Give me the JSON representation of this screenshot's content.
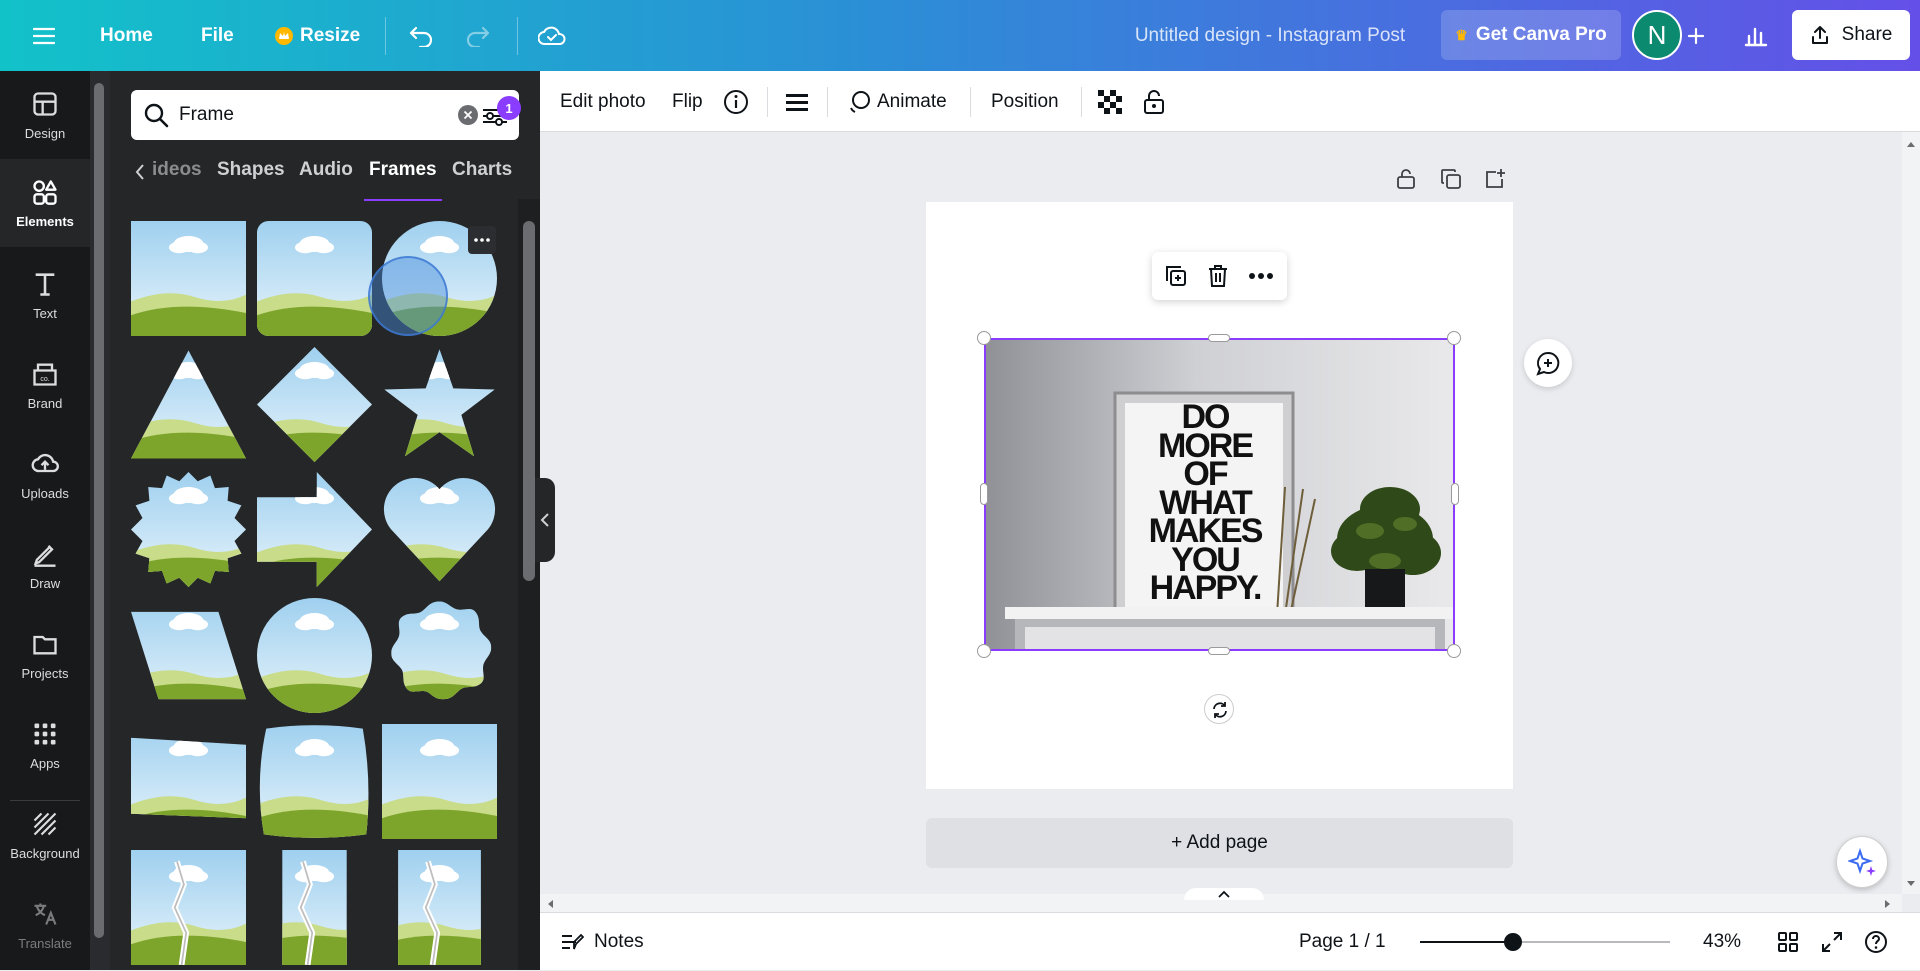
{
  "topbar": {
    "home_label": "Home",
    "file_label": "File",
    "resize_label": "Resize",
    "doc_title": "Untitled design - Instagram Post",
    "pro_label": "Get Canva Pro",
    "avatar_initial": "N",
    "share_label": "Share",
    "gradient": [
      "#12c2c9",
      "#6450e8"
    ]
  },
  "rail": {
    "items": [
      {
        "label": "Design",
        "icon": "design-icon"
      },
      {
        "label": "Elements",
        "icon": "elements-icon",
        "active": true
      },
      {
        "label": "Text",
        "icon": "text-icon"
      },
      {
        "label": "Brand",
        "icon": "brand-icon"
      },
      {
        "label": "Uploads",
        "icon": "uploads-icon"
      },
      {
        "label": "Draw",
        "icon": "draw-icon"
      },
      {
        "label": "Projects",
        "icon": "projects-icon"
      },
      {
        "label": "Apps",
        "icon": "apps-icon"
      },
      {
        "label": "Background",
        "icon": "background-icon"
      },
      {
        "label": "Translate",
        "icon": "translate-icon"
      }
    ]
  },
  "panel": {
    "search_value": "Frame",
    "filter_badge": "1",
    "tabs": [
      "ideos",
      "Shapes",
      "Audio",
      "Frames",
      "Charts"
    ],
    "active_tab": "Frames",
    "frame_shapes": [
      "rectangle",
      "rounded-rectangle",
      "circle",
      "triangle",
      "diamond",
      "star",
      "badge",
      "arrow",
      "heart",
      "parallelogram",
      "circle",
      "flower",
      "skewed",
      "torn-rounded",
      "tall-rectangle",
      "cracked-a",
      "cracked-b",
      "cracked-c"
    ]
  },
  "context_toolbar": {
    "edit_photo": "Edit photo",
    "flip": "Flip",
    "animate": "Animate",
    "position": "Position"
  },
  "canvas": {
    "add_page": "+ Add page",
    "poster_lines": [
      "DO",
      "MORE",
      "OF",
      "WHAT",
      "MAKES",
      "YOU",
      "HAPPY."
    ]
  },
  "bottombar": {
    "notes": "Notes",
    "page_indicator": "Page 1 / 1",
    "zoom": "43%",
    "zoom_fraction": 0.37
  },
  "colors": {
    "accent": "#8b3dff",
    "rail_bg": "#18191b",
    "panel_bg": "#252627",
    "frame_sky": "#cfe6f7",
    "frame_grass": "#7ea52b"
  }
}
